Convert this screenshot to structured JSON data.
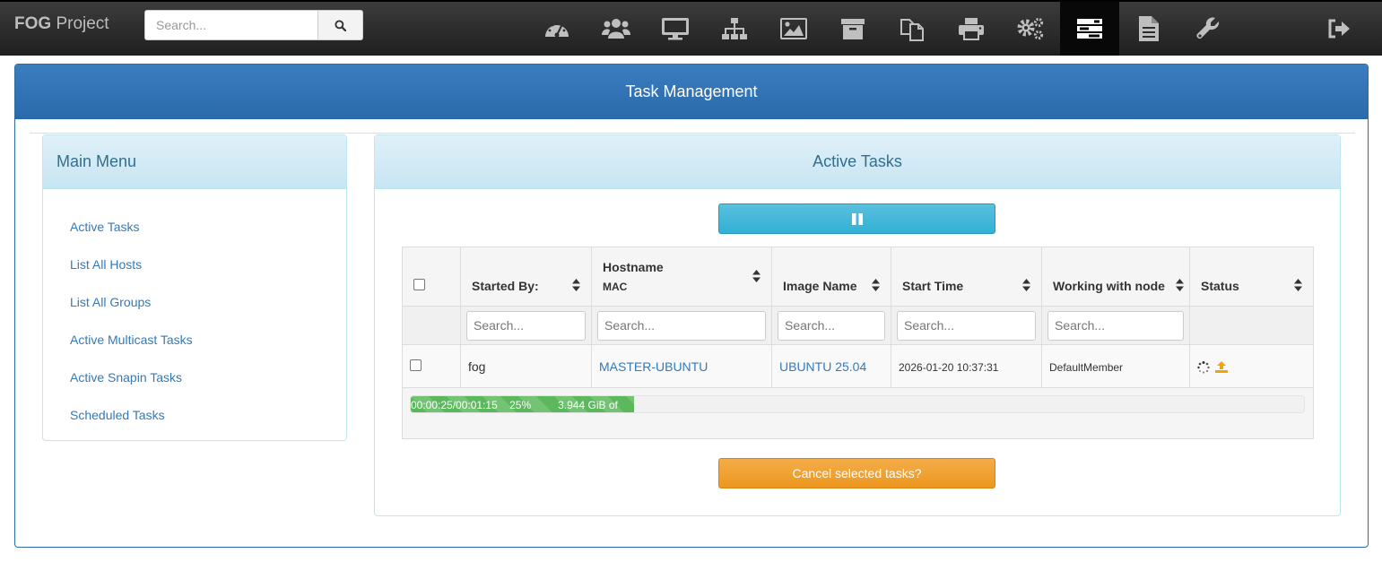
{
  "navbar": {
    "brand_bold": "FOG",
    "brand_rest": " Project",
    "search_placeholder": "Search...",
    "icons": [
      "dashboard-icon",
      "users-icon",
      "desktop-icon",
      "sitemap-icon",
      "image-icon",
      "archive-icon",
      "copy-icon",
      "print-icon",
      "cogs-icon",
      "tasks-icon",
      "file-icon",
      "wrench-icon",
      "logout-icon"
    ],
    "active_icon": "tasks-icon"
  },
  "page": {
    "title": "Task Management"
  },
  "menu": {
    "title": "Main Menu",
    "items": [
      "Active Tasks",
      "List All Hosts",
      "List All Groups",
      "Active Multicast Tasks",
      "Active Snapin Tasks",
      "Scheduled Tasks"
    ]
  },
  "tasks": {
    "title": "Active Tasks",
    "pause_icon": "pause-icon",
    "columns": {
      "started_by": "Started By:",
      "hostname": "Hostname",
      "hostname_sub": "MAC",
      "image_name": "Image Name",
      "start_time": "Start Time",
      "working_node": "Working with node",
      "status": "Status"
    },
    "filter_placeholder": "Search...",
    "rows": [
      {
        "started_by": "fog",
        "hostname": "MASTER-UBUNTU",
        "image_name": "UBUNTU 25.04",
        "start_time": "2026-01-20 10:37:31",
        "node": "DefaultMember",
        "status_icons": [
          "spinner-icon",
          "upload-icon"
        ],
        "progress_text": "00:00:25/00:01:15    25%         3.944 GiB of",
        "progress_percent": 25
      }
    ],
    "cancel_label": "Cancel selected tasks?"
  },
  "colors": {
    "navbar": "#2a2a2a",
    "primary": "#2a6aab",
    "info_button": "#31b0d5",
    "warning_button": "#ec971f",
    "progress": "#5cb85c",
    "link": "#337ab7"
  }
}
